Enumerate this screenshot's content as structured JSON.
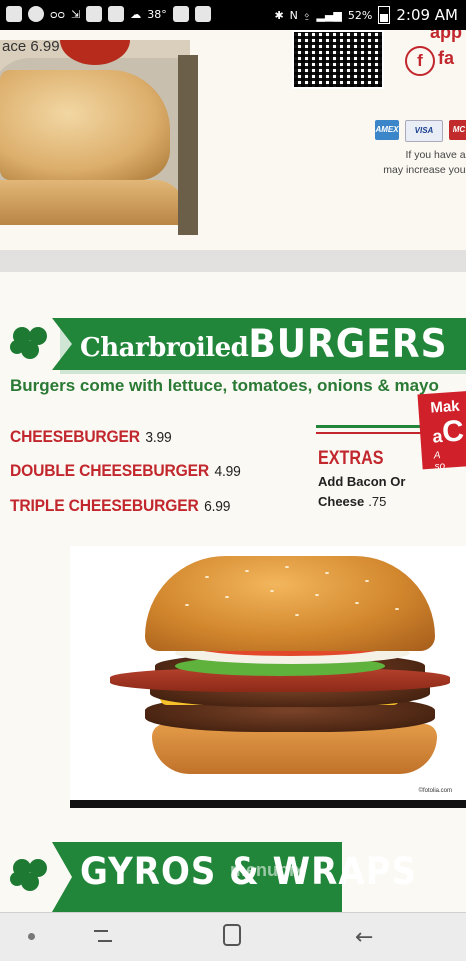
{
  "status_bar": {
    "temperature": "38°",
    "battery_percent": "52%",
    "time": "2:09 AM",
    "left_icons": [
      "messages-icon",
      "messenger-icon",
      "voicemail-icon",
      "cast-icon",
      "mail-icon",
      "gallery-icon",
      "cloud-icon",
      "youtube-icon",
      "app-icon"
    ],
    "right_icons": [
      "bluetooth-icon",
      "nfc-icon",
      "vibrate-icon",
      "signal-icon",
      "battery-icon"
    ]
  },
  "top_card": {
    "cropped_price": "ace 6.99",
    "app_label": "app",
    "facebook_label": "fa",
    "payment_cards": [
      "AMEX",
      "VISA",
      "MC"
    ],
    "allergy_lines": [
      "If you have a particu",
      "may increase your risk of"
    ]
  },
  "burgers": {
    "title_small": "Charbroiled",
    "title_big": "BURGERS",
    "subtitle": "Burgers come with lettuce, tomatoes, onions & mayo",
    "items": [
      {
        "name": "CHEESEBURGER",
        "price": "3.99"
      },
      {
        "name": "DOUBLE CHEESEBURGER",
        "price": "4.99"
      },
      {
        "name": "TRIPLE CHEESEBURGER",
        "price": "6.99"
      }
    ],
    "extras": {
      "title": "EXTRAS",
      "line1": "Add Bacon Or",
      "line2_label": "Cheese",
      "line2_price": ".75"
    },
    "promo": {
      "line1": "Mak",
      "line2_a": "a",
      "line2_b": "C",
      "line3": "A",
      "line4": "so"
    },
    "photo_credit": "©fotolia.com"
  },
  "gyros": {
    "title": "GYROS & WRAPS"
  },
  "watermark": "menupix",
  "nav_bar": {
    "buttons": [
      "nav-dot",
      "recents-button",
      "home-button",
      "back-button"
    ]
  },
  "colors": {
    "brand_green": "#22863a",
    "brand_red": "#c1272d",
    "background": "#fbf9f4"
  }
}
